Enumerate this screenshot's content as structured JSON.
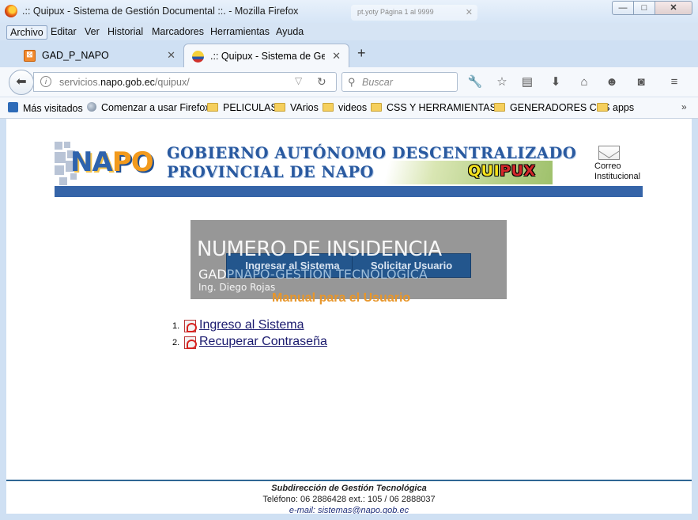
{
  "window": {
    "title": ".:: Quipux - Sistema de Gestión Documental ::. - Mozilla Firefox",
    "ghost_tab_text": "pt.yoty Página 1 al 9999",
    "min": "—",
    "max": "□",
    "close": "✕"
  },
  "menubar": {
    "items": [
      "Archivo",
      "Editar",
      "Ver",
      "Historial",
      "Marcadores",
      "Herramientas",
      "Ayuda"
    ]
  },
  "tabs": [
    {
      "label": "GAD_P_NAPO",
      "favicon": "xampp-icon"
    },
    {
      "label": ".:: Quipux - Sistema de Ges...",
      "favicon": "ecuador-shield-icon"
    }
  ],
  "navbar": {
    "url_prefix": "servicios.",
    "url_domain": "napo.gob.ec",
    "url_path": "/quipux/",
    "search_placeholder": "Buscar"
  },
  "bookmarks": [
    {
      "label": "Más visitados",
      "icon": "most-visited-icon"
    },
    {
      "label": "Comenzar a usar Firefox",
      "icon": "globe-icon"
    },
    {
      "label": "PELICULAS",
      "icon": "folder-icon"
    },
    {
      "label": "VArios",
      "icon": "folder-icon"
    },
    {
      "label": "videos",
      "icon": "folder-icon"
    },
    {
      "label": "CSS Y HERRAMIENTAS...",
      "icon": "folder-icon"
    },
    {
      "label": "GENERADORES CSS",
      "icon": "folder-icon"
    },
    {
      "label": "apps",
      "icon": "folder-icon"
    }
  ],
  "banner": {
    "logo_a": "NA",
    "logo_b": "PO",
    "line1": "GOBIERNO AUTÓNOMO DESCENTRALIZADO",
    "line2": "PROVINCIAL DE NAPO",
    "quipux_a": "QUI",
    "quipux_b": "PUX",
    "mail_line1": "Correo",
    "mail_line2": "Institucional"
  },
  "main": {
    "btn_ingresar": "Ingresar al Sistema",
    "btn_solicitar": "Solicitar Usuario",
    "manual_title": "Manual para el Usuario",
    "manuals": [
      {
        "num": "1.",
        "label": "Ingreso al Sistema"
      },
      {
        "num": "2.",
        "label": "Recuperar Contraseña"
      }
    ]
  },
  "watermark": {
    "title": "NUMERO DE INSIDENCIA",
    "sub_a": "GAD",
    "sub_b": "PNAPO-GESTION TECNOLOGICA",
    "name": "Ing. Diego Rojas"
  },
  "footer": {
    "line1": "Subdirección de Gestión Tecnológica",
    "line2": "Teléfono: 06 2886428 ext.: 105 /  06 2888037",
    "line3": "e-mail: sistemas@napo.gob.ec"
  },
  "colors": {
    "banner_blue": "#3564a8",
    "button_blue": "#23568d",
    "manual_orange": "#e8962a",
    "footer_line": "#2f6694"
  }
}
